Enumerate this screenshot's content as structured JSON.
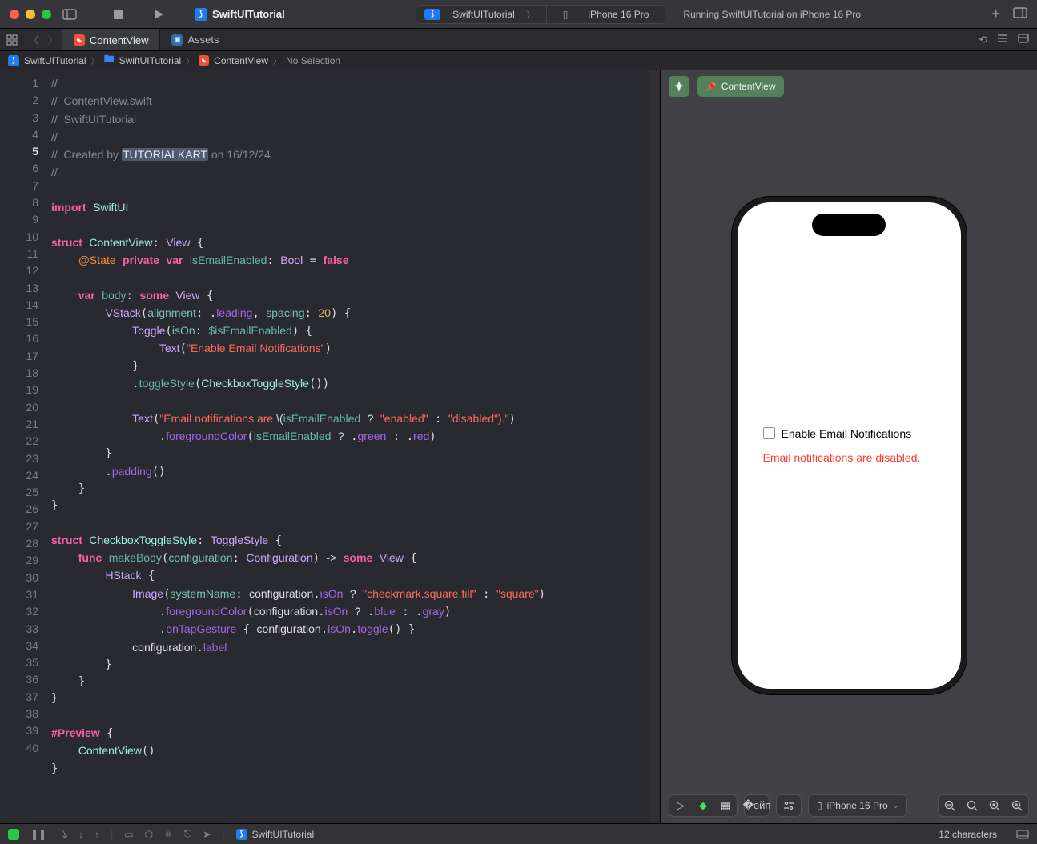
{
  "titlebar": {
    "project": "SwiftUITutorial",
    "scheme_app": "SwiftUITutorial",
    "scheme_device": "iPhone 16 Pro",
    "status": "Running SwiftUITutorial on iPhone 16 Pro"
  },
  "tabs": {
    "active": "ContentView",
    "assets": "Assets"
  },
  "breadcrumb": {
    "project": "SwiftUITutorial",
    "folder": "SwiftUITutorial",
    "file": "ContentView",
    "selection": "No Selection"
  },
  "editor": {
    "line_numbers": [
      "1",
      "2",
      "3",
      "4",
      "5",
      "6",
      "7",
      "8",
      "9",
      "10",
      "11",
      "12",
      "13",
      "14",
      "15",
      "16",
      "17",
      "18",
      "19",
      "20",
      "21",
      "22",
      "23",
      "24",
      "25",
      "26",
      "27",
      "28",
      "29",
      "30",
      "31",
      "32",
      "33",
      "34",
      "35",
      "36",
      "37",
      "38",
      "39",
      "40"
    ],
    "current_line": "5",
    "comments": {
      "l1": "//",
      "l2": "//  ContentView.swift",
      "l3": "//  SwiftUITutorial",
      "l4": "//",
      "l5a": "//  Created by ",
      "l5b": "TUTORIALKART",
      "l5c": " on 16/12/24.",
      "l6": "//"
    },
    "tok": {
      "import": "import",
      "SwiftUI": "SwiftUI",
      "struct": "struct",
      "ContentView": "ContentView",
      "View": "View",
      "State": "@State",
      "private": "private",
      "var": "var",
      "isEmailEnabled": "isEmailEnabled",
      "Bool": "Bool",
      "false": "false",
      "body": "body",
      "some": "some",
      "VStack": "VStack",
      "alignment": "alignment",
      "leading": "leading",
      "spacing": "spacing",
      "twenty": "20",
      "Toggle": "Toggle",
      "isOn": "isOn",
      "binding": "$isEmailEnabled",
      "Text": "Text",
      "str_enable": "\"Enable Email Notifications\"",
      "toggleStyle": "toggleStyle",
      "CheckboxToggleStyle": "CheckboxToggleStyle",
      "str_interp_a": "\"Email notifications are ",
      "esc": "\\(",
      "q": "?",
      "enabled": "\"enabled\"",
      "disabled": "\"disabled\"",
      "str_interp_b": ").\"",
      "foregroundColor": "foregroundColor",
      "green": "green",
      "red": "red",
      "padding": "padding",
      "ToggleStyle": "ToggleStyle",
      "func": "func",
      "makeBody": "makeBody",
      "configuration": "configuration",
      "Configuration": "Configuration",
      "arrow": "->",
      "HStack": "HStack",
      "Image": "Image",
      "systemName": "systemName",
      "checkmark": "\"checkmark.square.fill\"",
      "square": "\"square\"",
      "blue": "blue",
      "gray": "gray",
      "onTapGesture": "onTapGesture",
      "toggle": "toggle",
      "label": "label",
      "Preview": "#Preview"
    }
  },
  "preview": {
    "chip": "ContentView",
    "toggle_label": "Enable Email Notifications",
    "status_text": "Email notifications are disabled.",
    "device": "iPhone 16 Pro"
  },
  "debugbar": {
    "project": "SwiftUITutorial",
    "chars": "12 characters"
  }
}
